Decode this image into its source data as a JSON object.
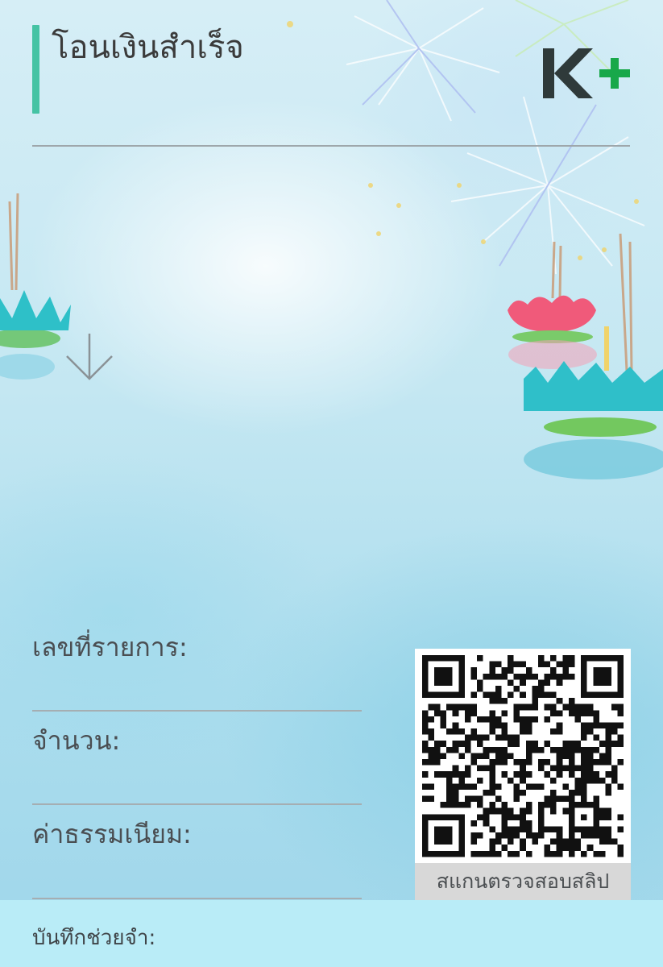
{
  "header": {
    "title": "โอนเงินสำเร็จ",
    "logo_text": "K+",
    "logo_colors": {
      "k": "#2f3a3a",
      "plus": "#18a84a"
    }
  },
  "icons": {
    "arrow": "arrow-down-icon"
  },
  "fields": {
    "transaction_no_label": "เลขที่รายการ:",
    "amount_label": "จำนวน:",
    "fee_label": "ค่าธรรมเนียม:"
  },
  "qr": {
    "caption": "สแกนตรวจสอบสลิป"
  },
  "memo": {
    "label": "บันทึกช่วยจำ:"
  },
  "colors": {
    "accent": "#45c3a4",
    "memo_background": "#b9ecf7"
  }
}
